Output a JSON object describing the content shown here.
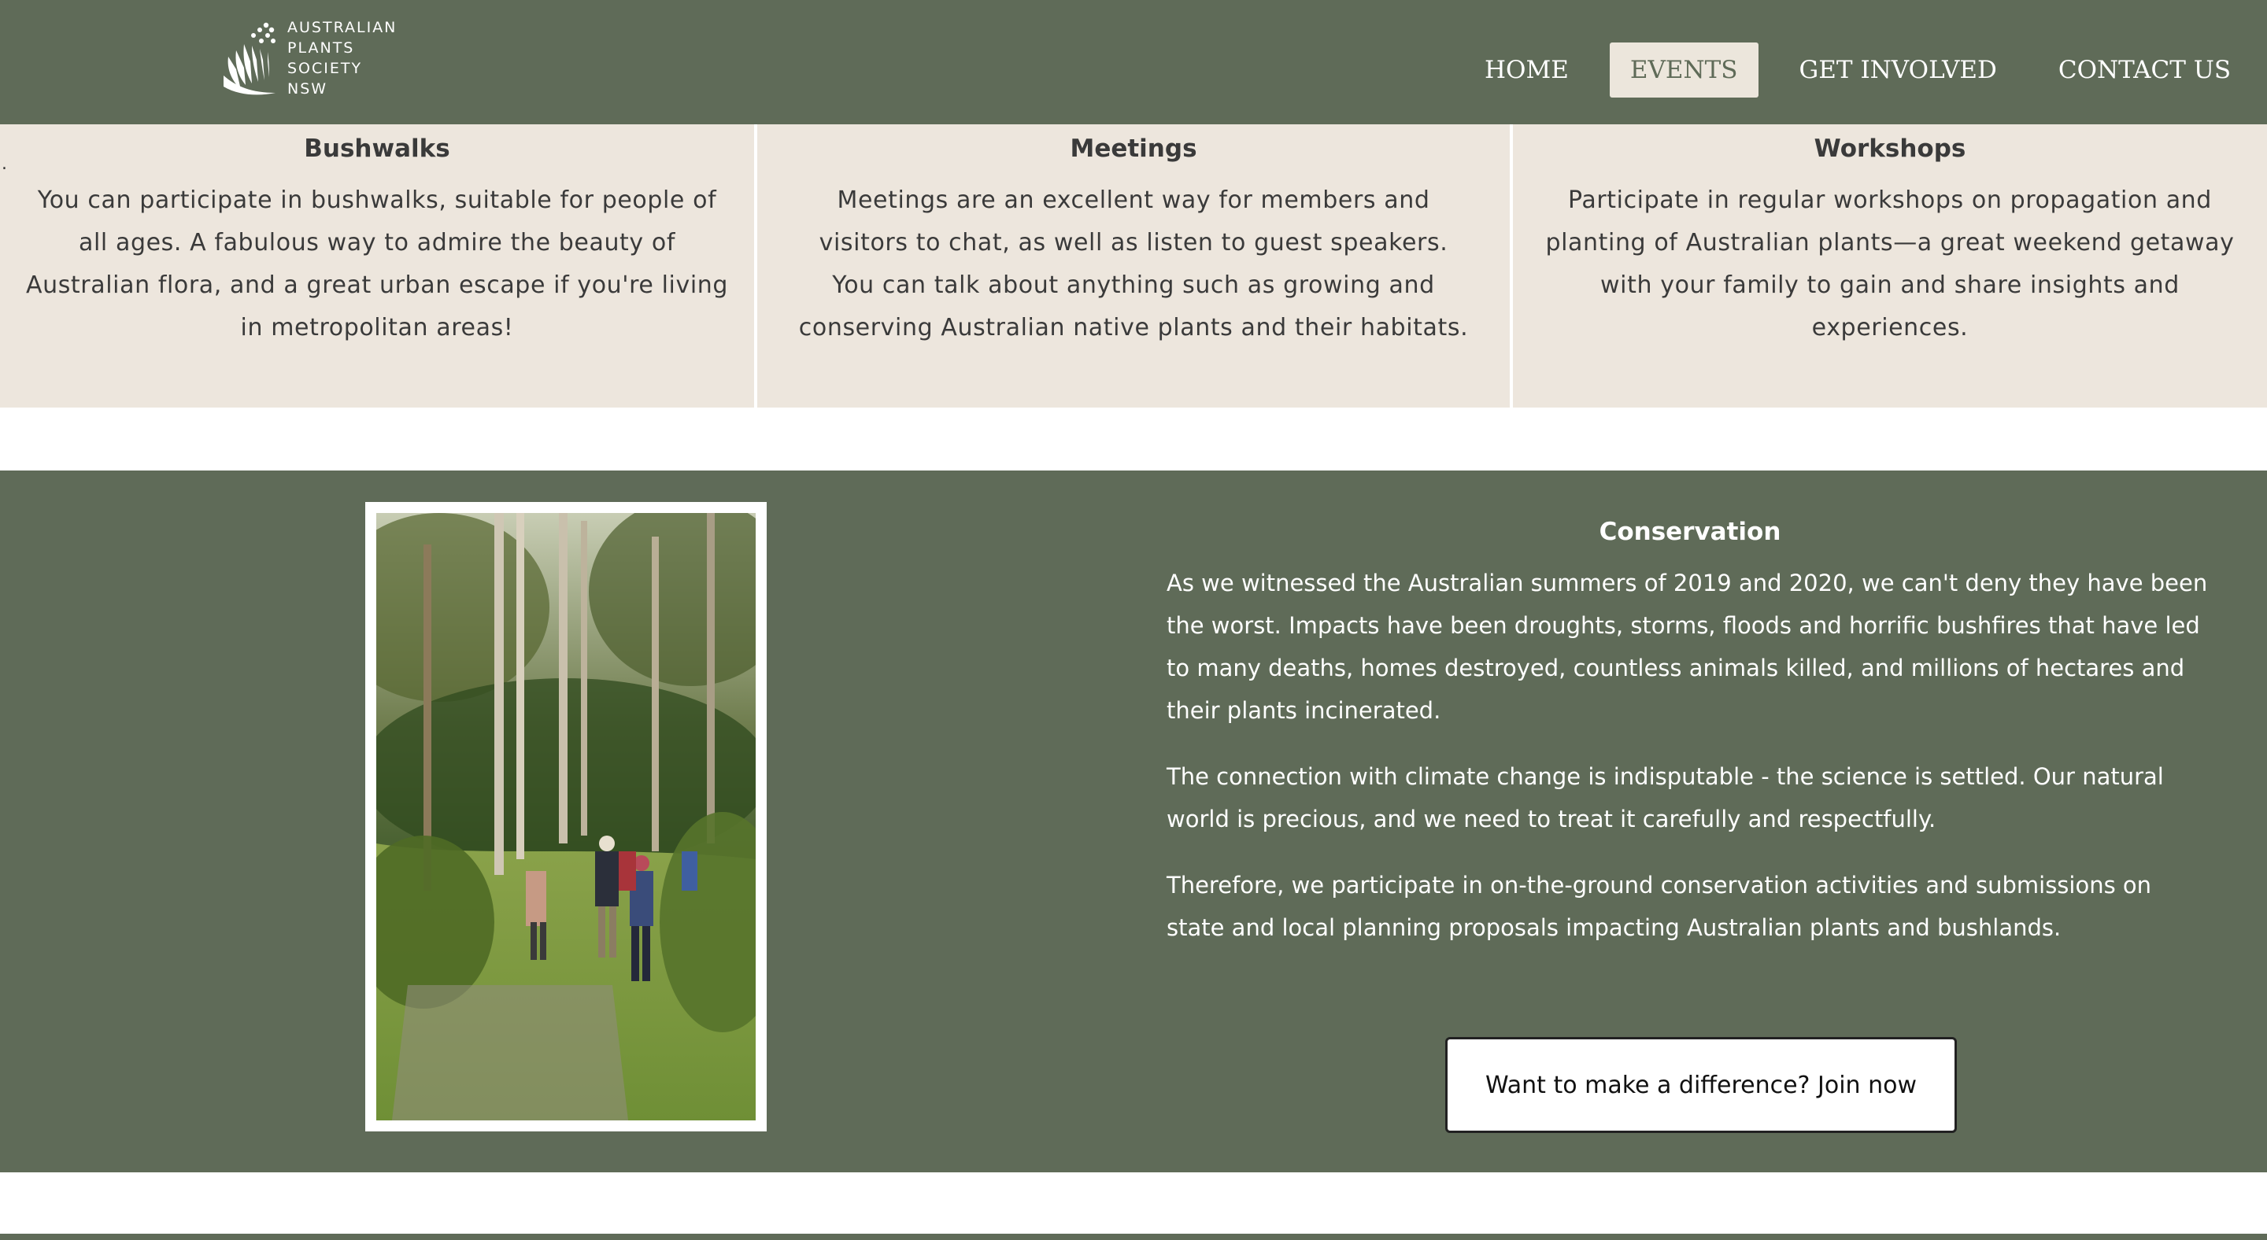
{
  "logo": {
    "lines": [
      "AUSTRALIAN",
      "PLANTS",
      "SOCIETY",
      "NSW"
    ]
  },
  "nav": {
    "items": [
      {
        "label": "HOME"
      },
      {
        "label": "EVENTS"
      },
      {
        "label": "GET INVOLVED"
      },
      {
        "label": "CONTACT US"
      }
    ],
    "active": "EVENTS"
  },
  "cards": [
    {
      "title": "Bushwalks",
      "body": "You can participate in bushwalks, suitable for people of all ages. A fabulous way to admire the beauty of Australian flora, and a great urban escape if you're living in metropolitan areas!"
    },
    {
      "title": "Meetings",
      "body": "Meetings are an excellent way for members and visitors to chat, as well as listen to guest speakers. You can talk about anything such as growing and conserving Australian native plants and their habitats."
    },
    {
      "title": "Workshops",
      "body": "Participate in regular workshops on propagation and planting of Australian plants—a great weekend getaway with your family to gain and share insights and experiences."
    }
  ],
  "stray_mark": ".",
  "conservation": {
    "title": "Conservation",
    "paragraphs": [
      "As we witnessed the Australian summers of 2019 and 2020, we can't deny they have been the worst. Impacts have been droughts, storms, floods and horrific bushfires that have led to many deaths, homes destroyed, countless animals killed, and millions of hectares and their plants incinerated.",
      "The connection with climate change is indisputable - the science is settled. Our natural world is precious, and we need to treat it carefully and respectfully.",
      "Therefore, we participate in on-the-ground conservation activities and submissions on state and local planning proposals impacting Australian plants and bushlands."
    ],
    "join_label": "Want to make a difference? Join now"
  },
  "colors": {
    "header_green": "#5f6b58",
    "card_beige": "#ede6dd",
    "active_nav_bg": "#ece6dc",
    "text_dark": "#3a3a3a"
  }
}
